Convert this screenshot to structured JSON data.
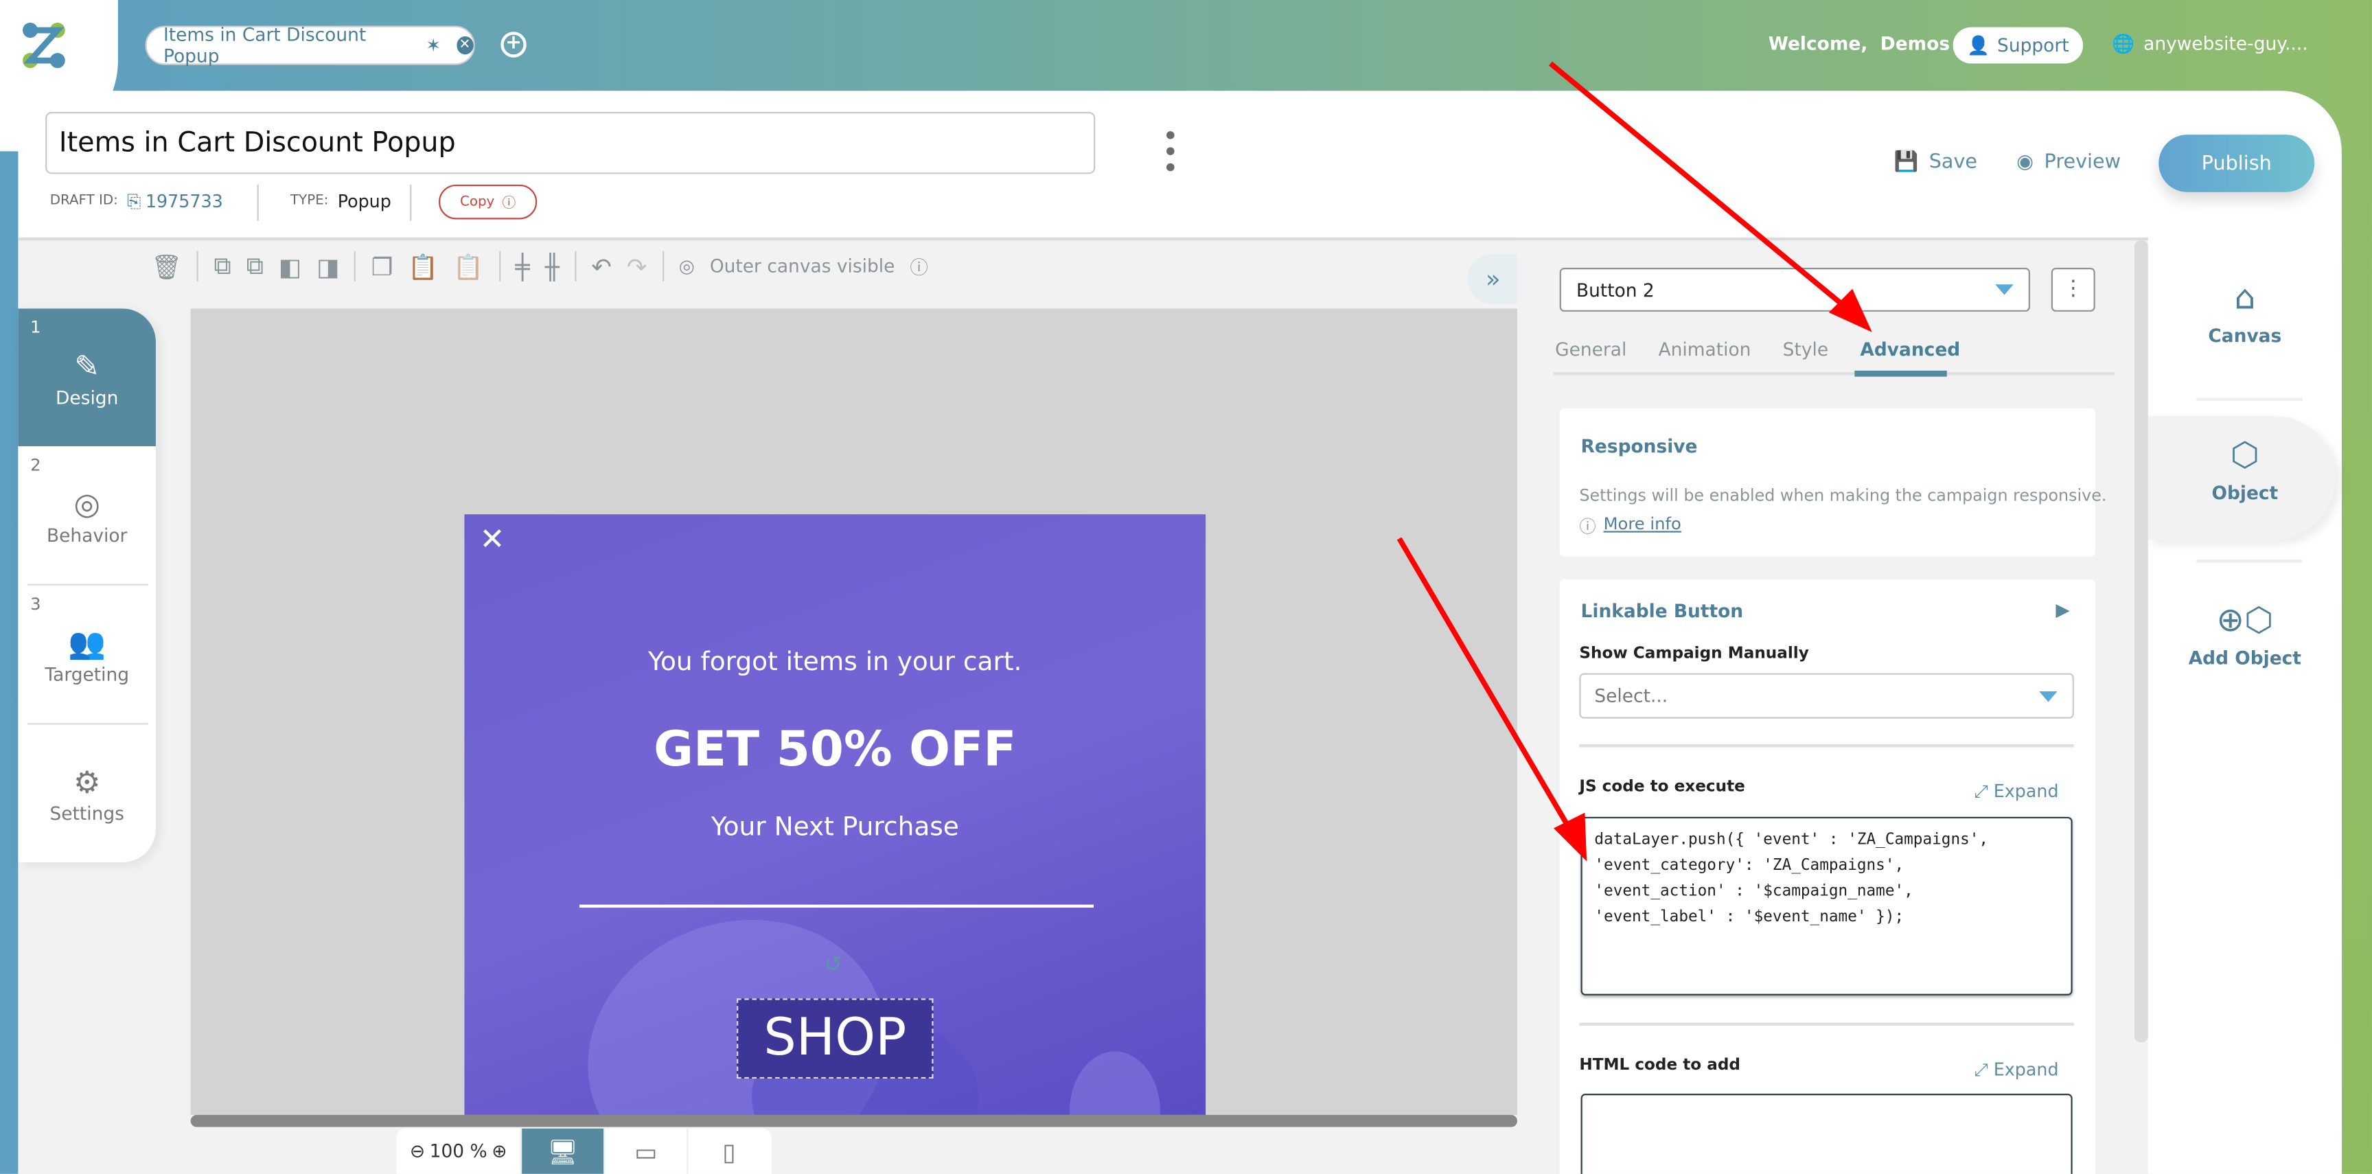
{
  "topbar": {
    "tab_title": "Items in Cart Discount Popup",
    "tab_modified_marker": "✶",
    "welcome_label": "Welcome,",
    "user_name": "Demos",
    "support_label": "Support",
    "site_label": "anywebsite-guy...."
  },
  "header": {
    "campaign_name": "Items in Cart Discount Popup",
    "draft_id_label": "DRAFT ID:",
    "draft_id": "1975733",
    "type_label": "TYPE:",
    "type_value": "Popup",
    "copy_label": "Copy",
    "save_label": "Save",
    "preview_label": "Preview",
    "publish_label": "Publish"
  },
  "toolbar": {
    "outer_canvas_label": "Outer canvas visible",
    "outer_canvas_enabled": false
  },
  "steps": [
    {
      "number": "1",
      "label": "Design",
      "icon": "edit-icon",
      "active": true
    },
    {
      "number": "2",
      "label": "Behavior",
      "icon": "target-icon",
      "active": false
    },
    {
      "number": "3",
      "label": "Targeting",
      "icon": "people-icon",
      "active": false
    },
    {
      "number": "",
      "label": "Settings",
      "icon": "gears-icon",
      "active": false
    }
  ],
  "popup": {
    "line1": "You forgot items in your cart.",
    "headline": "GET 50% OFF",
    "line2": "Your Next Purchase",
    "button_label": "SHOP",
    "close_glyph": "✕",
    "background_color": "#6c5fd0"
  },
  "zoom": {
    "value": "100 %"
  },
  "panel": {
    "selected_object": "Button 2",
    "tabs": [
      "General",
      "Animation",
      "Style",
      "Advanced"
    ],
    "active_tab": "Advanced",
    "responsive": {
      "title": "Responsive",
      "description": "Settings will be enabled when making the campaign responsive.",
      "more_info": "More info"
    },
    "linkable": {
      "title": "Linkable Button",
      "show_campaign_label": "Show Campaign Manually",
      "show_campaign_placeholder": "Select...",
      "js_label": "JS code to execute",
      "expand_label": "Expand",
      "js_code": "dataLayer.push({ 'event' : 'ZA_Campaigns',\n'event_category': 'ZA_Campaigns',\n'event_action' : '$campaign_name',\n'event_label' : '$event_name' });",
      "html_label": "HTML code to add",
      "html_code": ""
    }
  },
  "rail": {
    "items": [
      {
        "label": "Canvas",
        "icon": "easel-icon",
        "active": false
      },
      {
        "label": "Object",
        "icon": "cube-icon",
        "active": true
      },
      {
        "label": "Add Object",
        "icon": "add-cube-icon",
        "active": false
      }
    ]
  },
  "colors": {
    "accent": "#578a9f",
    "publish": "#62a4d0",
    "annotation_arrow": "#ff0000",
    "copy_red": "#c9453e"
  }
}
